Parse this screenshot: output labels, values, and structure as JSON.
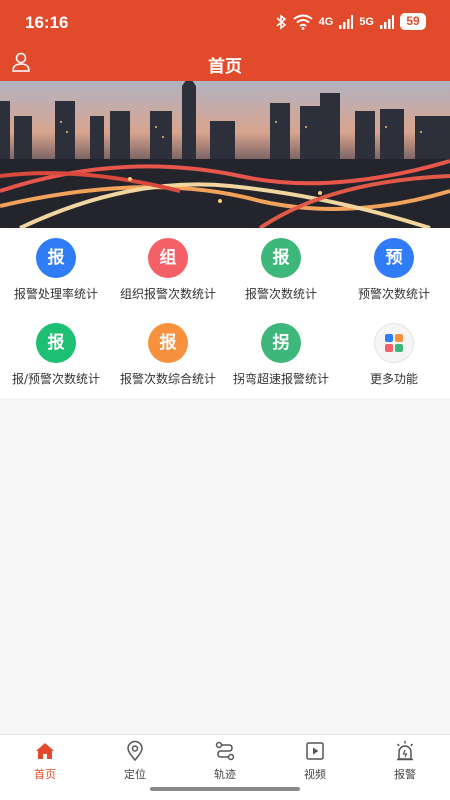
{
  "status_bar": {
    "time": "16:16",
    "network_4g": "4G",
    "network_5g": "5G",
    "battery": "59"
  },
  "header": {
    "title": "首页"
  },
  "colors": {
    "primary": "#e14a2a",
    "blue": "#2f7cf6",
    "red": "#f46066",
    "green": "#3db87a",
    "teal": "#1dbf73",
    "orange": "#f7913d"
  },
  "grid": {
    "items": [
      {
        "glyph": "报",
        "label": "报警处理率统计",
        "color": "#2f7cf6"
      },
      {
        "glyph": "组",
        "label": "组织报警次数统计",
        "color": "#f46066"
      },
      {
        "glyph": "报",
        "label": "报警次数统计",
        "color": "#3db87a"
      },
      {
        "glyph": "预",
        "label": "预警次数统计",
        "color": "#2f7cf6"
      },
      {
        "glyph": "报",
        "label": "报/预警次数统计",
        "color": "#1dbf73"
      },
      {
        "glyph": "报",
        "label": "报警次数综合统计",
        "color": "#f7913d"
      },
      {
        "glyph": "拐",
        "label": "拐弯超速报警统计",
        "color": "#3db87a"
      },
      {
        "glyph": "",
        "label": "更多功能",
        "color": ""
      }
    ]
  },
  "bottom_nav": {
    "items": [
      {
        "label": "首页",
        "icon": "home-icon",
        "active": true
      },
      {
        "label": "定位",
        "icon": "location-pin-icon",
        "active": false
      },
      {
        "label": "轨迹",
        "icon": "route-icon",
        "active": false
      },
      {
        "label": "视频",
        "icon": "video-icon",
        "active": false
      },
      {
        "label": "报警",
        "icon": "alarm-icon",
        "active": false
      }
    ]
  }
}
